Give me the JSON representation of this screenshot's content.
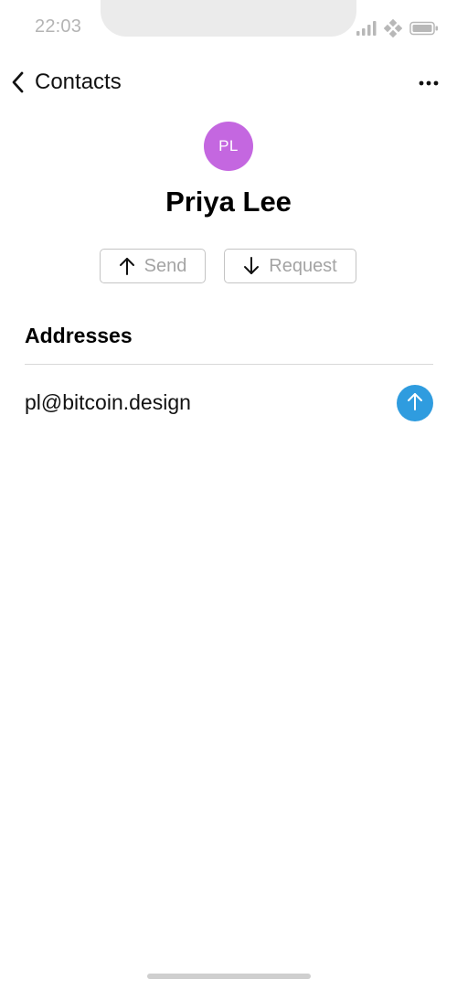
{
  "status_bar": {
    "time": "22:03",
    "icons": [
      "cellular-signal-icon",
      "network-icon",
      "battery-icon"
    ]
  },
  "nav": {
    "back_label": "Contacts",
    "back_icon": "chevron-left-icon",
    "more_icon": "more-dots-icon"
  },
  "contact": {
    "initials": "PL",
    "name": "Priya Lee",
    "avatar_color": "#c467e0"
  },
  "actions": {
    "send_label": "Send",
    "send_icon": "arrow-up-icon",
    "request_label": "Request",
    "request_icon": "arrow-down-icon"
  },
  "addresses": {
    "header": "Addresses",
    "items": [
      {
        "address": "pl@bitcoin.design",
        "icon": "arrow-up-icon"
      }
    ]
  },
  "colors": {
    "accent": "#2f9cdf",
    "muted_text": "#a4a4a4",
    "button_border": "#c4c4c4"
  }
}
